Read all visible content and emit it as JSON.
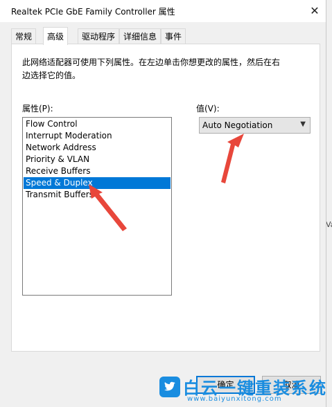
{
  "window": {
    "title": "Realtek PCIe GbE Family Controller 属性",
    "close_glyph": "✕"
  },
  "tabs": [
    {
      "label": "常规",
      "active": false
    },
    {
      "label": "高级",
      "active": true
    },
    {
      "label": "驱动程序",
      "active": false
    },
    {
      "label": "详细信息",
      "active": false
    },
    {
      "label": "事件",
      "active": false
    }
  ],
  "panel": {
    "description": "此网络适配器可使用下列属性。在左边单击你想更改的属性，然后在右边选择它的值。",
    "property_label": "属性(P):",
    "value_label": "值(V):",
    "properties": [
      "Flow Control",
      "Interrupt Moderation",
      "Network Address",
      "Priority & VLAN",
      "Receive Buffers",
      "Speed & Duplex",
      "Transmit Buffers"
    ],
    "selected_property": "Speed & Duplex",
    "value_selected": "Auto Negotiation",
    "combo_arrow_icon": "chevron-down-icon"
  },
  "buttons": {
    "ok": "确定",
    "cancel": "取消"
  },
  "watermark": {
    "brand": "白云一键重装系统",
    "url": "www.baiyunxitong.com"
  },
  "background": {
    "edge_text": "Va"
  },
  "colors": {
    "selection": "#0078d7",
    "annotation_arrow": "#e8473b",
    "watermark": "#1a8de0"
  }
}
